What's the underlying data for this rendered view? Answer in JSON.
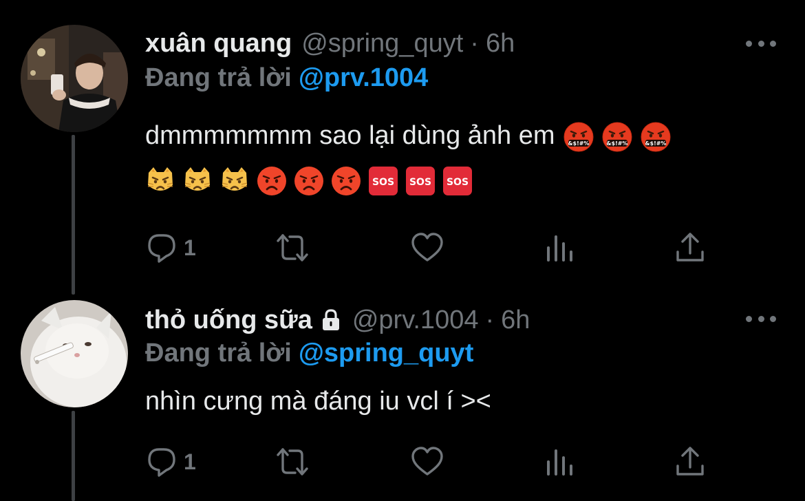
{
  "tweets": [
    {
      "name": "xuân quang",
      "handle": "@spring_quyt",
      "separator": "·",
      "time": "6h",
      "replying_label": "Đang trả lời",
      "replying_to": "@prv.1004",
      "text": "dmmmmmmm sao lại dùng ảnh em",
      "reply_count": "1"
    },
    {
      "name": "thỏ uống sữa",
      "handle": "@prv.1004",
      "separator": "·",
      "time": "6h",
      "replying_label": "Đang trả lời",
      "replying_to": "@spring_quyt",
      "text": "nhìn cưng mà đáng iu vcl í ><",
      "reply_count": "1"
    }
  ],
  "emoji_sets": {
    "inline": [
      "face-with-symbols-on-mouth",
      "face-with-symbols-on-mouth",
      "face-with-symbols-on-mouth"
    ],
    "row": [
      "pouting-cat",
      "pouting-cat",
      "pouting-cat",
      "pouting-face",
      "pouting-face",
      "pouting-face",
      "sos-button",
      "sos-button",
      "sos-button"
    ]
  },
  "sos_label": "SOS",
  "symbols_label": "&$!#%",
  "colors": {
    "background": "#000000",
    "text": "#e7e9ea",
    "muted": "#71767b",
    "accent": "#1d9bf0",
    "thread_line": "#3e4144"
  }
}
